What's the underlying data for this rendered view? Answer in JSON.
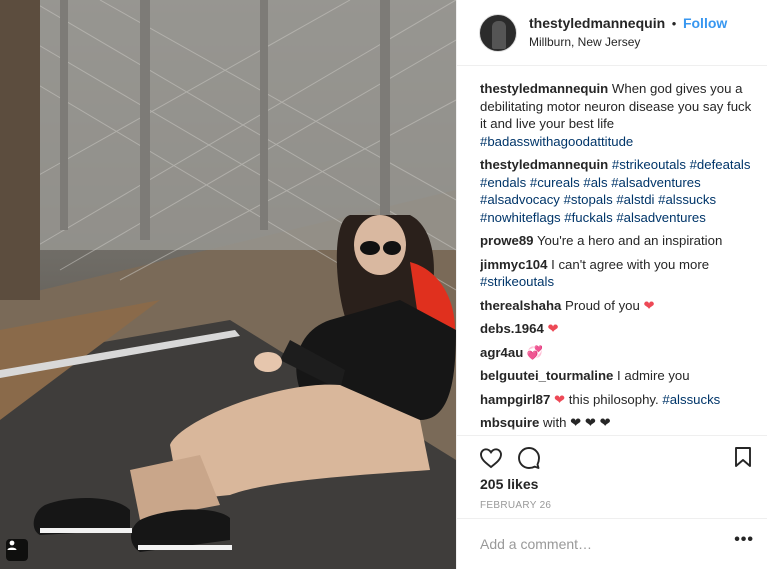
{
  "post": {
    "username": "thestyledmannequin",
    "separator": "•",
    "follow_label": "Follow",
    "location": "Millburn, New Jersey"
  },
  "comments": [
    {
      "user": "thestyledmannequin",
      "text": "When god gives you a debilitating motor neuron disease you say fuck it and live your best life",
      "tags": "#badasswithagoodattitude"
    },
    {
      "user": "thestyledmannequin",
      "text": "",
      "tags": "#strikeoutals #defeatals #endals #cureals #als #alsadventures #alsadvocacy #stopals #alstdi #alssucks #nowhiteflags #fuckals #alsadventures"
    },
    {
      "user": "prowe89",
      "text": "You're a hero and an inspiration",
      "tags": ""
    },
    {
      "user": "jimmyc104",
      "text": "I can't agree with you more",
      "tags": "#strikeoutals"
    },
    {
      "user": "therealshaha",
      "text": "Proud of you",
      "emoji": "❤"
    },
    {
      "user": "debs.1964",
      "text": "",
      "emoji": "❤"
    },
    {
      "user": "agr4au",
      "text": "",
      "emoji": "💞"
    },
    {
      "user": "belguutei_tourmaline",
      "text": "I admire you",
      "tags": ""
    },
    {
      "user": "hampgirl87",
      "text": "this philosophy.",
      "emoji": "❤",
      "tags": "#alssucks"
    },
    {
      "user": "mbsquire",
      "text": "with ❤ ❤ ❤",
      "tags": ""
    }
  ],
  "actions": {
    "likes": "205 likes",
    "date": "FEBRUARY 26"
  },
  "add_comment": {
    "placeholder": "Add a comment…",
    "more": "•••"
  },
  "icons": {
    "like": "heart-icon",
    "comment": "comment-icon",
    "save": "bookmark-icon",
    "tagged": "person-tag-icon"
  },
  "colors": {
    "follow": "#3897f0",
    "hashtag": "#003569",
    "heart": "#ed4956"
  }
}
